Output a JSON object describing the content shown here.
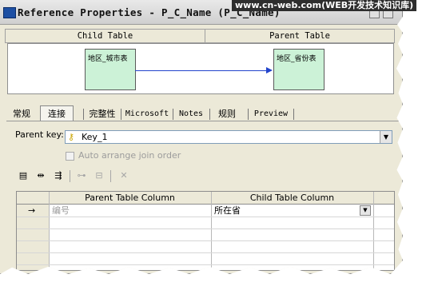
{
  "window": {
    "title": "Reference Properties - P_C_Name (P_C_Name)",
    "watermark": "www.cn-web.com(WEB开发技术知识库)"
  },
  "diagram": {
    "child_header": "Child Table",
    "parent_header": "Parent Table",
    "child_table_name": "地区_城市表",
    "parent_table_name": "地区_省份表"
  },
  "tabs": [
    "常规",
    "连接",
    "完整性",
    "Microsoft",
    "Notes",
    "规则",
    "Preview"
  ],
  "active_tab": "连接",
  "join": {
    "parent_key_label": "Parent key:",
    "parent_key_value": "Key_1",
    "auto_arrange_label": "Auto arrange join order",
    "auto_arrange_checked": false
  },
  "toolbar": {
    "icons": [
      "properties-icon",
      "add-row-icon",
      "reuse-columns-icon",
      "insert-row-icon",
      "delete-column-icon",
      "delete-icon"
    ]
  },
  "grid": {
    "columns": [
      "Parent Table Column",
      "Child Table Column"
    ],
    "rows": [
      {
        "parent": "编号",
        "child": "所在省",
        "current": true
      }
    ],
    "current_row_marker": "→"
  },
  "colors": {
    "table_box_fill": "#ccf2d7",
    "relation_line": "#2244cc"
  }
}
